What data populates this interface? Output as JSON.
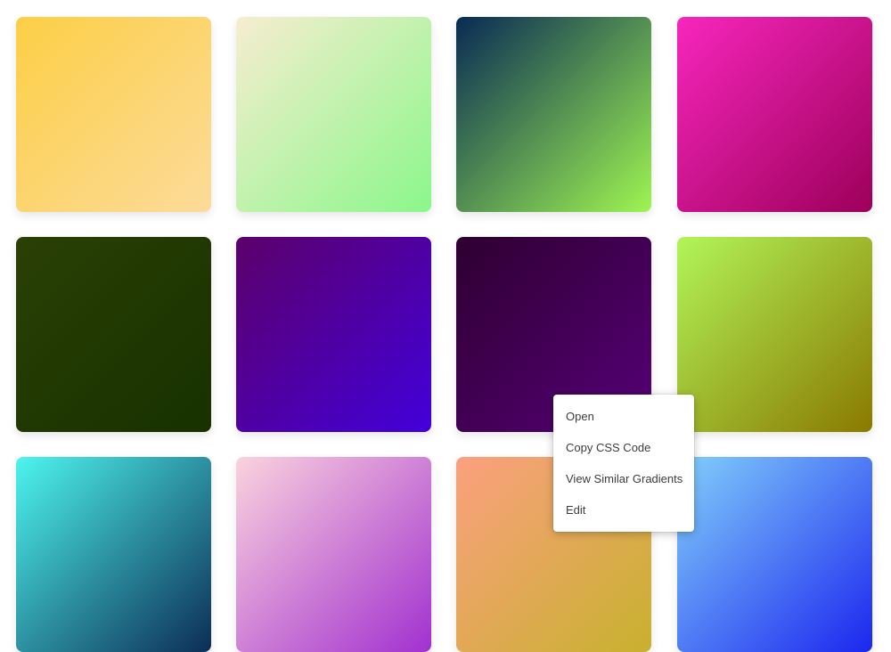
{
  "gradients": [
    {
      "id": "tile-1",
      "from": "#fccf45",
      "to": "#fcdb9a"
    },
    {
      "id": "tile-2",
      "from": "#f7edd0",
      "to": "#8bf78a"
    },
    {
      "id": "tile-3",
      "from": "#082a54",
      "to": "#9ff552"
    },
    {
      "id": "tile-4",
      "from": "#f726bd",
      "to": "#9c005a"
    },
    {
      "id": "tile-5",
      "from": "#2a4004",
      "to": "#173100"
    },
    {
      "id": "tile-6",
      "from": "#5c006a",
      "to": "#4200db"
    },
    {
      "id": "tile-7",
      "from": "#2e0030",
      "to": "#560078"
    },
    {
      "id": "tile-8",
      "from": "#b1f55a",
      "to": "#8a7900"
    },
    {
      "id": "tile-9",
      "from": "#4df5ee",
      "to": "#0c2d56"
    },
    {
      "id": "tile-10",
      "from": "#fbd3de",
      "to": "#a230cf"
    },
    {
      "id": "tile-11",
      "from": "#fba07f",
      "to": "#c8b12e"
    },
    {
      "id": "tile-12",
      "from": "#82d0fb",
      "to": "#1c26ef"
    }
  ],
  "context_menu": {
    "items": [
      {
        "label": "Open"
      },
      {
        "label": "Copy CSS Code"
      },
      {
        "label": "View Similar Gradients"
      },
      {
        "label": "Edit"
      }
    ]
  }
}
